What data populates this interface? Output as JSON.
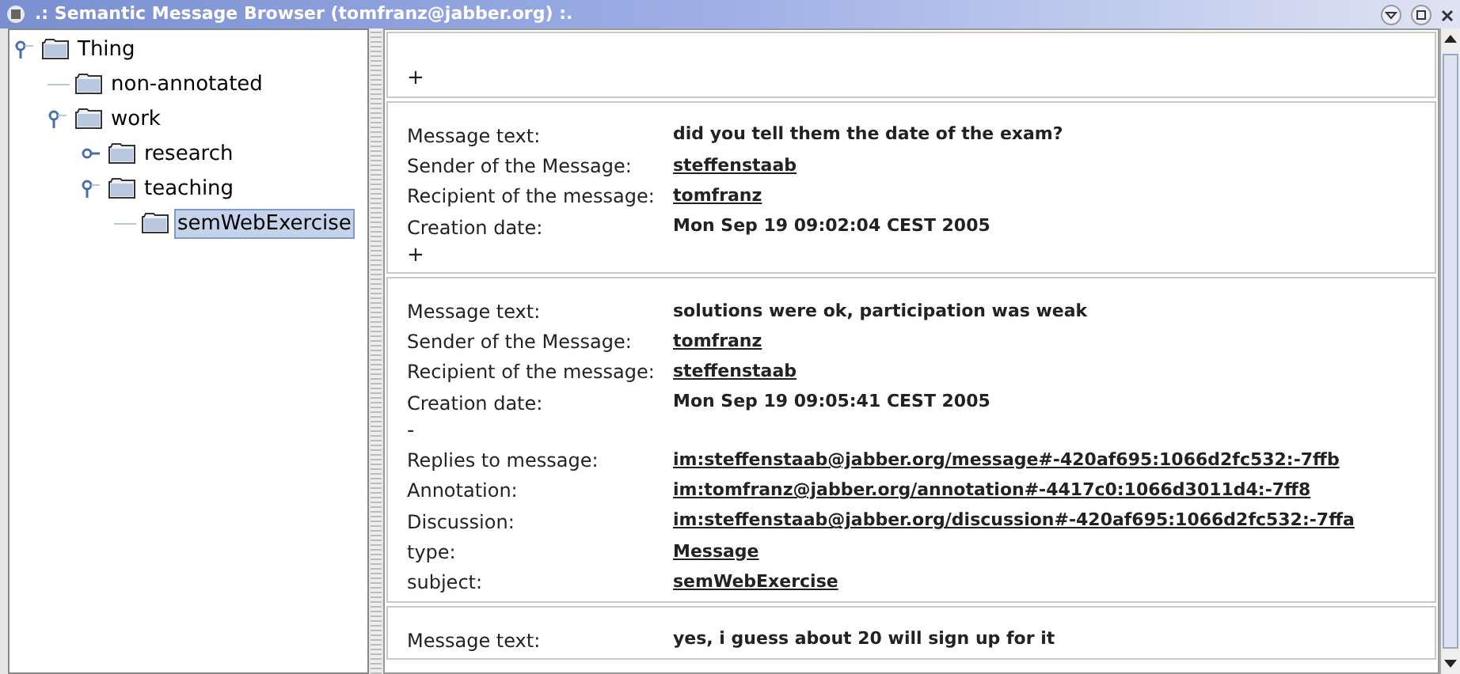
{
  "window": {
    "title": ".: Semantic Message Browser (tomfranz@jabber.org) :."
  },
  "tree": [
    {
      "label": "Thing",
      "expanded": true,
      "selected": false,
      "children": [
        {
          "label": "non-annotated",
          "selected": false
        },
        {
          "label": "work",
          "expanded": true,
          "selected": false,
          "children": [
            {
              "label": "research",
              "expanded": false,
              "selected": false
            },
            {
              "label": "teaching",
              "expanded": true,
              "selected": false,
              "children": [
                {
                  "label": "semWebExercise",
                  "selected": true
                }
              ]
            }
          ]
        }
      ]
    }
  ],
  "messages": [
    {
      "toggle": "+"
    },
    {
      "fields": [
        {
          "label": "Message text:",
          "value": "did you tell them the date of the exam?",
          "kind": "text"
        },
        {
          "label": "Sender of the Message:",
          "value": "steffenstaab",
          "kind": "link"
        },
        {
          "label": "Recipient of the message:",
          "value": "tomfranz",
          "kind": "link"
        },
        {
          "label": "Creation date:",
          "value": "Mon Sep 19 09:02:04 CEST 2005",
          "kind": "text"
        }
      ],
      "toggle": "+"
    },
    {
      "fields": [
        {
          "label": "Message text:",
          "value": "solutions were ok, participation was weak",
          "kind": "text"
        },
        {
          "label": "Sender of the Message:",
          "value": "tomfranz",
          "kind": "link"
        },
        {
          "label": "Recipient of the message:",
          "value": "steffenstaab",
          "kind": "link"
        },
        {
          "label": "Creation date:",
          "value": "Mon Sep 19 09:05:41 CEST 2005",
          "kind": "text"
        }
      ],
      "toggle": "-",
      "details": [
        {
          "label": "Replies to message:",
          "value": "im:steffenstaab@jabber.org/message#-420af695:1066d2fc532:-7ffb",
          "kind": "link"
        },
        {
          "label": "Annotation:",
          "value": "im:tomfranz@jabber.org/annotation#-4417c0:1066d3011d4:-7ff8",
          "kind": "link"
        },
        {
          "label": "Discussion:",
          "value": "im:steffenstaab@jabber.org/discussion#-420af695:1066d2fc532:-7ffa",
          "kind": "link"
        },
        {
          "label": "type:",
          "value": "Message",
          "kind": "link"
        },
        {
          "label": "subject:",
          "value": "semWebExercise",
          "kind": "link"
        }
      ]
    },
    {
      "fields": [
        {
          "label": "Message text:",
          "value": "yes, i guess about 20 will sign up for it",
          "kind": "text"
        }
      ]
    }
  ]
}
